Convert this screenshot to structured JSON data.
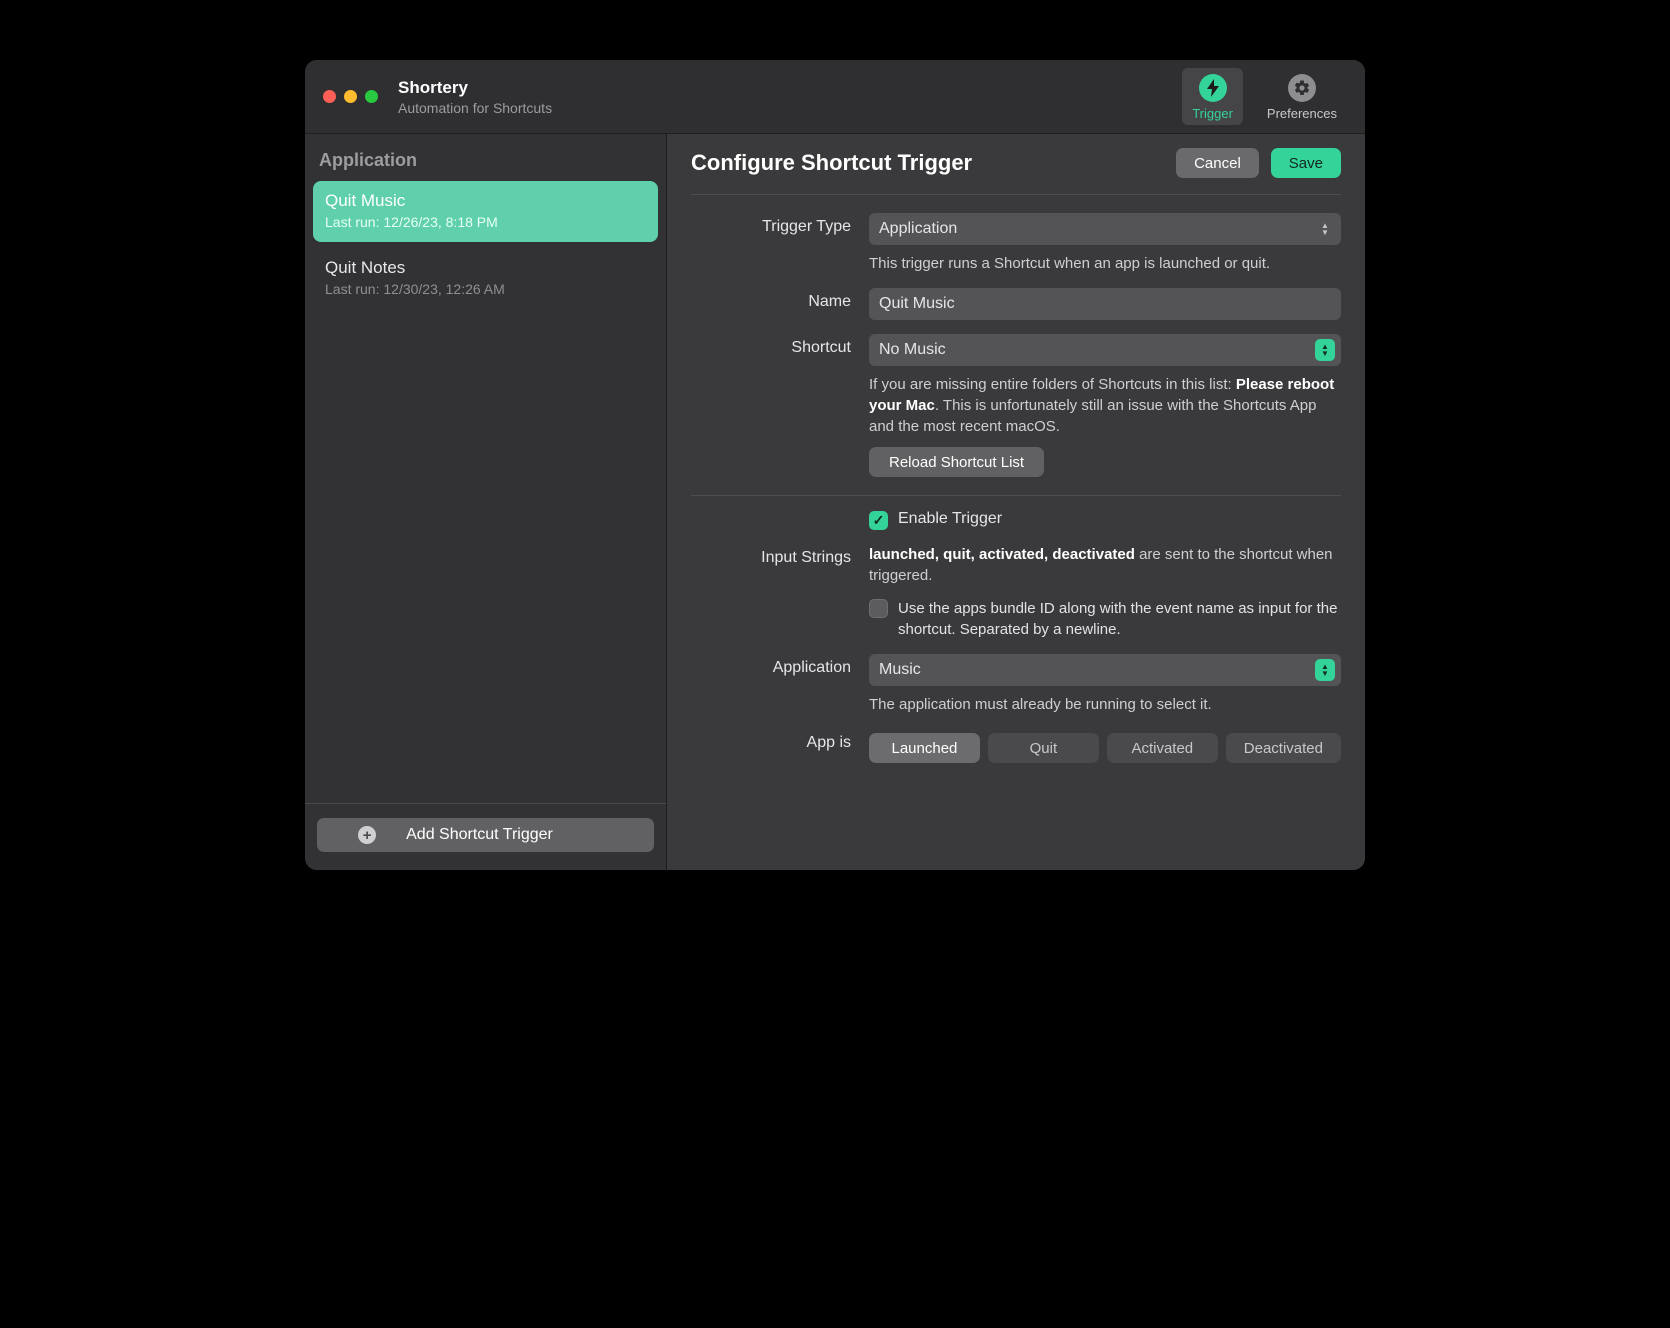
{
  "app": {
    "name": "Shortery",
    "subtitle": "Automation for Shortcuts"
  },
  "toolbar": {
    "trigger_label": "Trigger",
    "preferences_label": "Preferences"
  },
  "sidebar": {
    "header": "Application",
    "items": [
      {
        "title": "Quit Music",
        "subtitle": "Last run: 12/26/23, 8:18 PM",
        "selected": true
      },
      {
        "title": "Quit Notes",
        "subtitle": "Last run: 12/30/23, 12:26 AM",
        "selected": false
      }
    ],
    "add_button": "Add Shortcut Trigger"
  },
  "main": {
    "title": "Configure Shortcut Trigger",
    "cancel": "Cancel",
    "save": "Save",
    "trigger_type_label": "Trigger Type",
    "trigger_type_value": "Application",
    "trigger_type_help": "This trigger runs a Shortcut when an app is launched or quit.",
    "name_label": "Name",
    "name_value": "Quit Music",
    "shortcut_label": "Shortcut",
    "shortcut_value": "No Music",
    "shortcut_help_pre": "If you are missing entire folders of Shortcuts in this list: ",
    "shortcut_help_bold": "Please reboot your Mac",
    "shortcut_help_post": ". This is unfortunately still an issue with the Shortcuts App and the most recent macOS.",
    "reload_label": "Reload Shortcut List",
    "enable_label": "Enable Trigger",
    "input_strings_label": "Input Strings",
    "input_strings_bold": "launched, quit, activated, deactivated",
    "input_strings_rest": " are sent to the shortcut when triggered.",
    "bundle_id_label": "Use the apps bundle ID along with the event name as input for the shortcut. Separated by a newline.",
    "application_label": "Application",
    "application_value": "Music",
    "application_help": "The application must already be running to select it.",
    "app_is_label": "App is",
    "seg": {
      "launched": "Launched",
      "quit": "Quit",
      "activated": "Activated",
      "deactivated": "Deactivated"
    }
  }
}
